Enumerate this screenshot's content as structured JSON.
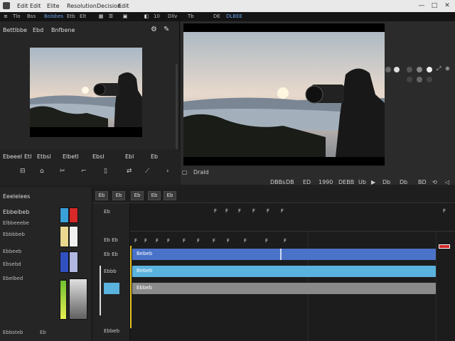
{
  "titlebar": {
    "menus": [
      "Edit",
      "Edit",
      "Elite",
      "Resolution",
      "Decision",
      "Edit"
    ],
    "win_controls": [
      "minimize-icon",
      "maximize-icon",
      "close-icon"
    ]
  },
  "toolbar": {
    "items": [
      "Tlo",
      "Bss",
      "Bolsbes",
      "Etb",
      "Elt"
    ],
    "right_items": [
      "10",
      "Dllv",
      "Tb",
      "DE",
      "DLBEE"
    ]
  },
  "media_panel": {
    "tabs": [
      "Bettlbbe",
      "Ebd",
      "Bnfbene"
    ],
    "icons": [
      "gear-icon",
      "settings-icon"
    ]
  },
  "media_controls": {
    "row1": [
      "Ebeeel",
      "Etl",
      "Etbsl",
      "Elbetl",
      "Ebsl",
      "Ebl",
      "Eb"
    ],
    "row2_icons": [
      "lock-icon",
      "home-icon",
      "scissors-icon",
      "trim-icon",
      "marker-icon",
      "shuffle-icon",
      "slip-icon",
      "next-icon"
    ]
  },
  "viewer": {
    "timecode": "Drald",
    "right_icons": [
      "fullscreen-icon",
      "zoom-icon"
    ]
  },
  "transport": {
    "items": [
      "DBBs",
      "DB",
      "ED",
      "1990",
      "DEBB",
      "Ub",
      "Db",
      "Db",
      "BD"
    ]
  },
  "library": {
    "title": "Eeelelees",
    "section": "Ebbeibeb",
    "items": [
      "Elbbeeebe",
      "Ebbbbeb",
      "Ebbeeb",
      "Ebsebd",
      "Ebelbed"
    ],
    "footer": [
      "Ebbsteb",
      "Eb"
    ],
    "swatch_colors": [
      "#3aa0d8",
      "#d82828",
      "#e8d890",
      "#f0f0f0",
      "#3050c0",
      "#b0b8e0",
      "#70c030",
      "#d0d0d0"
    ]
  },
  "timeline_header": {
    "buttons": [
      "Eb",
      "Eb",
      "Eb",
      "Eb",
      "Eb"
    ]
  },
  "track_labels": [
    "Eb",
    "Eb Eb",
    "Eb Eb",
    "Ebbb",
    "Ebbeb"
  ],
  "timeline": {
    "ruler_ticks_top": [
      "F",
      "F",
      "F",
      "F",
      "F",
      "F",
      "F"
    ],
    "ruler_ticks_bottom": [
      "F",
      "F",
      "F",
      "F",
      "F",
      "F",
      "F",
      "F",
      "F",
      "F",
      "F"
    ],
    "clips": [
      {
        "label": "Bebeb",
        "color": "#4a72c8"
      },
      {
        "label": "Bebeb",
        "color": "#5ab2de"
      },
      {
        "label": "Ebbeb",
        "color": "#8a8a8a"
      }
    ]
  }
}
